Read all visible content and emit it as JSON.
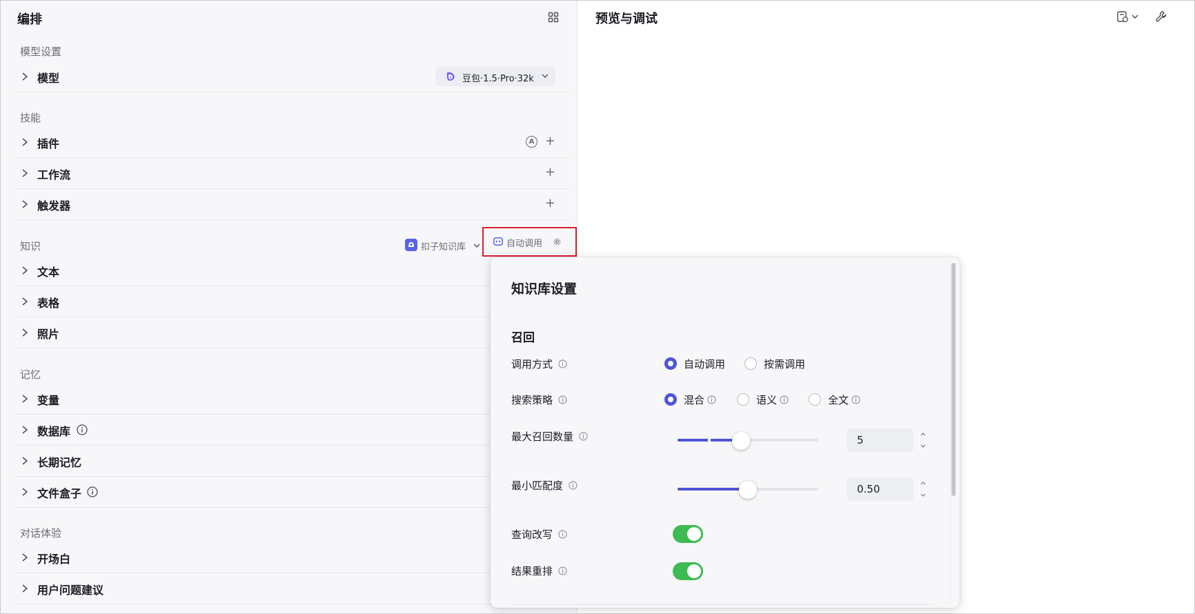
{
  "left_panel": {
    "title": "编排",
    "groups": {
      "model_settings": "模型设置",
      "skills": "技能",
      "knowledge": "知识",
      "memory": "记忆",
      "conversation": "对话体验"
    },
    "model": {
      "label": "模型",
      "selected_model": "豆包·1.5·Pro·32k"
    },
    "skills": [
      {
        "label": "插件"
      },
      {
        "label": "工作流"
      },
      {
        "label": "触发器"
      }
    ],
    "knowledge": {
      "kb_source": "扣子知识库",
      "call_mode_button": "自动调用",
      "items": [
        {
          "label": "文本"
        },
        {
          "label": "表格"
        },
        {
          "label": "照片"
        }
      ]
    },
    "memory": [
      {
        "label": "变量"
      },
      {
        "label": "数据库"
      },
      {
        "label": "长期记忆"
      },
      {
        "label": "文件盒子"
      }
    ],
    "conversation": [
      {
        "label": "开场白"
      },
      {
        "label": "用户问题建议"
      }
    ],
    "plugin_auto_badge": "A"
  },
  "right_panel": {
    "title": "预览与调试"
  },
  "kb_settings": {
    "title": "知识库设置",
    "section": "召回",
    "call_method": {
      "label": "调用方式",
      "options": [
        "自动调用",
        "按需调用"
      ],
      "selected": "自动调用"
    },
    "search_strategy": {
      "label": "搜索策略",
      "options": [
        "混合",
        "语义",
        "全文"
      ],
      "selected": "混合"
    },
    "max_recall": {
      "label": "最大召回数量",
      "value": "5",
      "slider_fraction": 0.45
    },
    "min_match": {
      "label": "最小匹配度",
      "value": "0.50",
      "slider_fraction": 0.5
    },
    "query_rewrite": {
      "label": "查询改写",
      "on": true
    },
    "result_rerank": {
      "label": "结果重排",
      "on": true
    }
  },
  "colors": {
    "accent": "#4f54d8",
    "toggle_on": "#3dbb52",
    "highlight_box": "#d81e2c"
  }
}
